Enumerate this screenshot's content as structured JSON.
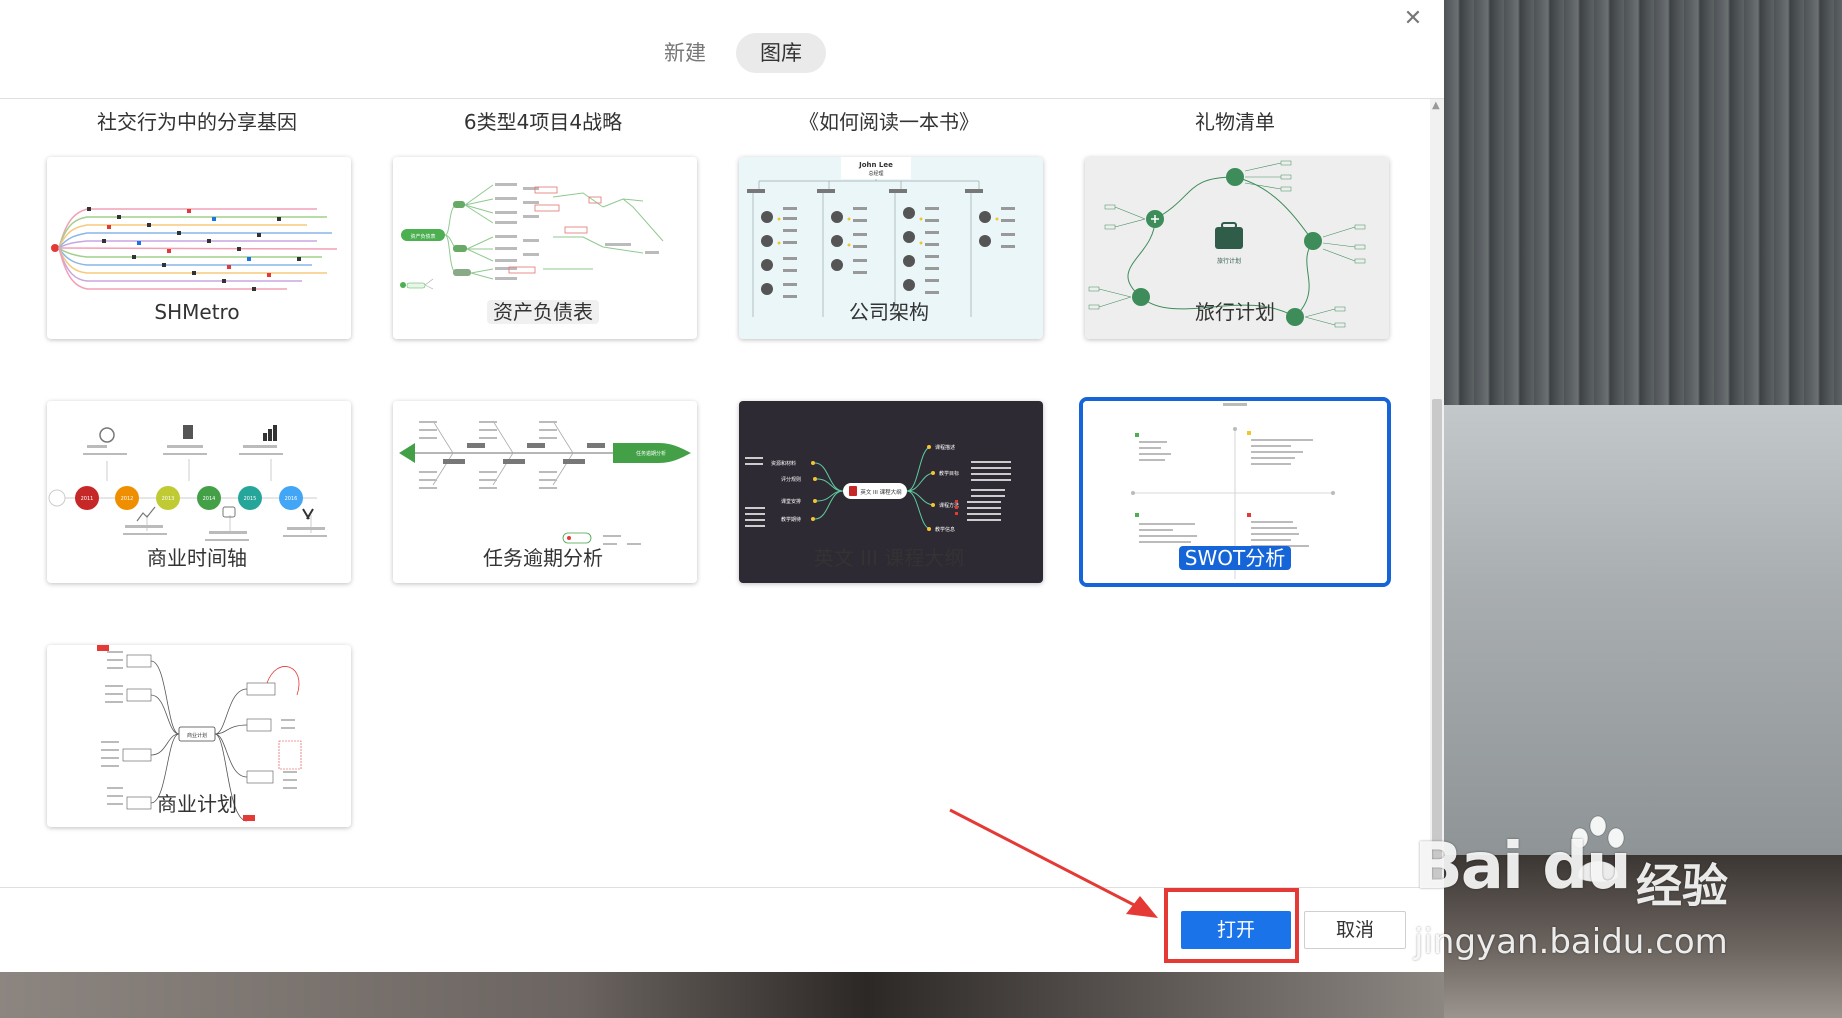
{
  "tabs": [
    {
      "label": "新建",
      "active": false
    },
    {
      "label": "图库",
      "active": true
    }
  ],
  "top_row_labels": [
    "社交行为中的分享基因",
    "6类型4项目4战略",
    "《如何阅读一本书》",
    "礼物清单"
  ],
  "templates": [
    {
      "label": "SHMetro"
    },
    {
      "label": "资产负债表"
    },
    {
      "label": "公司架构"
    },
    {
      "label": "旅行计划"
    },
    {
      "label": "商业时间轴"
    },
    {
      "label": "任务逾期分析"
    },
    {
      "label": "英文 III 课程大纲"
    },
    {
      "label": "SWOT分析"
    },
    {
      "label": "商业计划"
    }
  ],
  "thumb_text": {
    "org_name": "John Lee",
    "org_title": "总经理",
    "timeline_years": [
      "2011",
      "2012",
      "2013",
      "2014",
      "2015",
      "2016"
    ],
    "course_center": "英文 III 课程大纲",
    "course_left": [
      "资源和材料",
      "评分规则",
      "课堂安排",
      "教学期待"
    ],
    "course_right": [
      "课程描述",
      "教学目标",
      "课程方法",
      "教学信息"
    ],
    "travel_center": "旅行计划",
    "balance_root": "资产负债表",
    "task_head": "任务逾期分析",
    "biz_center": "商业计划"
  },
  "buttons": {
    "open": "打开",
    "cancel": "取消"
  },
  "watermark": {
    "logo": "Bai du",
    "jingyan": "经验",
    "url": "jingyan.baidu.com"
  },
  "colors": {
    "accent": "#1565d8",
    "open_button": "#1a73e8",
    "annotation": "#e53935",
    "travel_green": "#3d8c5a",
    "balance_green": "#4caf50",
    "course_bg": "#2d2a33"
  }
}
